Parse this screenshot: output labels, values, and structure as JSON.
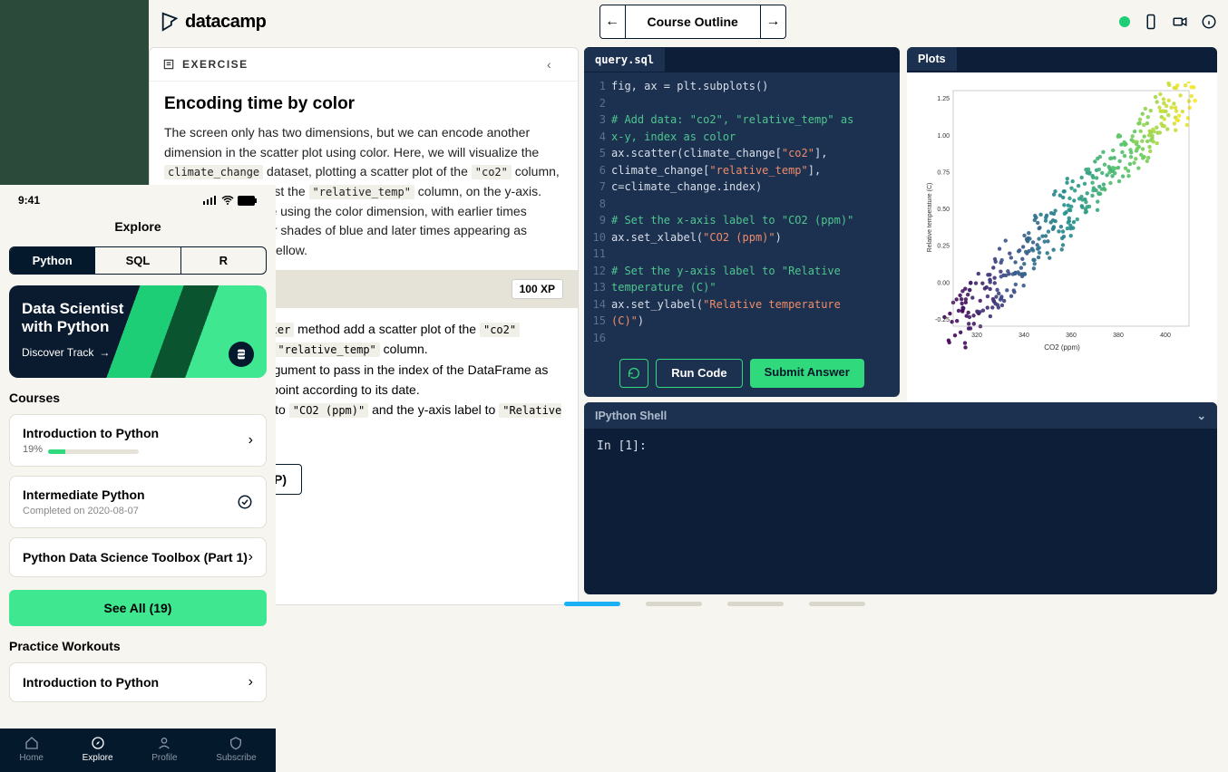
{
  "brand": "datacamp",
  "topbar": {
    "course_outline": "Course Outline"
  },
  "exercise": {
    "label": "EXERCISE",
    "title": "Encoding time by color",
    "body_html": "The screen only has two dimensions, but we can encode another dimension in the scatter plot using color. Here, we will visualize the <code>climate_change</code> dataset, plotting a scatter plot of the <code>\"co2\"</code> column, on the x-axis, against the <code>\"relative_temp\"</code> column, on the y-axis. We will encode time using the color dimension, with earlier times appearing as darker shades of blue and later times appearing as brighter shades of yellow.",
    "xp": "100 XP",
    "instructions_html": "Using the <code>ax.scatter</code> method add a scatter plot of the <code>\"co2\"</code> column against the <code>\"relative_temp\"</code> column.<br>Use the keyword argument to pass in the index of the DataFrame as input to color each point according to its date.<br>Set the x-axis label to <code>\"CO2 (ppm)\"</code> and the y-axis label to <code>\"Relative temperature (C)\"</code>.",
    "hint": "Take Hint (-30 XP)"
  },
  "editor": {
    "filename": "query.sql",
    "lines": [
      {
        "n": 1,
        "html": "fig, ax = plt.subplots()"
      },
      {
        "n": 2,
        "html": ""
      },
      {
        "n": 3,
        "html": "<span class='c-comment'># Add data: \"co2\", \"relative_temp\" as</span>"
      },
      {
        "n": 4,
        "html": "<span class='c-comment'>x-y, index as color</span>"
      },
      {
        "n": 5,
        "html": "ax.scatter(climate_change[<span class='c-str'>\"co2\"</span>],"
      },
      {
        "n": 6,
        "html": "climate_change[<span class='c-str'>\"relative_temp\"</span>],"
      },
      {
        "n": 7,
        "html": "c=climate_change.index)"
      },
      {
        "n": 8,
        "html": ""
      },
      {
        "n": 9,
        "html": "<span class='c-comment'># Set the x-axis label to \"CO2 (ppm)\"</span>"
      },
      {
        "n": 10,
        "html": "ax.set_xlabel(<span class='c-str'>\"CO2 (ppm)\"</span>)"
      },
      {
        "n": 11,
        "html": ""
      },
      {
        "n": 12,
        "html": "<span class='c-comment'># Set the y-axis label to \"Relative</span>"
      },
      {
        "n": 13,
        "html": "<span class='c-comment'>temperature (C)\"</span>"
      },
      {
        "n": 14,
        "html": "ax.set_ylabel(<span class='c-str'>\"Relative temperature</span>"
      },
      {
        "n": 15,
        "html": "<span class='c-str'>(C)\"</span>)"
      },
      {
        "n": 16,
        "html": ""
      }
    ],
    "run": "Run Code",
    "submit": "Submit Answer"
  },
  "plot_tab": "Plots",
  "chart_data": {
    "type": "scatter",
    "xlabel": "CO2 (ppm)",
    "ylabel": "Relative temperature (C)",
    "xlim": [
      310,
      410
    ],
    "ylim": [
      -0.3,
      1.3
    ],
    "xticks": [
      320,
      340,
      360,
      380,
      400
    ],
    "yticks": [
      -0.25,
      0.0,
      0.25,
      0.5,
      0.75,
      1.0,
      1.25
    ],
    "color_by": "time_index",
    "colormap": "viridis",
    "series": [
      {
        "name": "climate_change",
        "x": "co2",
        "y": "relative_temp"
      }
    ]
  },
  "shell": {
    "title": "IPython Shell",
    "prompt": "In [1]:"
  },
  "mobile": {
    "time": "9:41",
    "title": "Explore",
    "segments": [
      "Python",
      "SQL",
      "R"
    ],
    "promo_title": "Data Scientist\nwith Python",
    "promo_cta": "Discover Track",
    "courses_h": "Courses",
    "courses": [
      {
        "title": "Introduction to Python",
        "progress_pct": 19,
        "progress_label": "19%"
      },
      {
        "title": "Intermediate Python",
        "sub": "Completed on 2020-08-07",
        "completed": true
      },
      {
        "title": "Python Data Science Toolbox (Part 1)"
      }
    ],
    "see_all": "See All (19)",
    "practice_h": "Practice Workouts",
    "practice": [
      {
        "title": "Introduction to Python"
      }
    ],
    "nav": [
      "Home",
      "Explore",
      "Profile",
      "Subscribe"
    ]
  }
}
